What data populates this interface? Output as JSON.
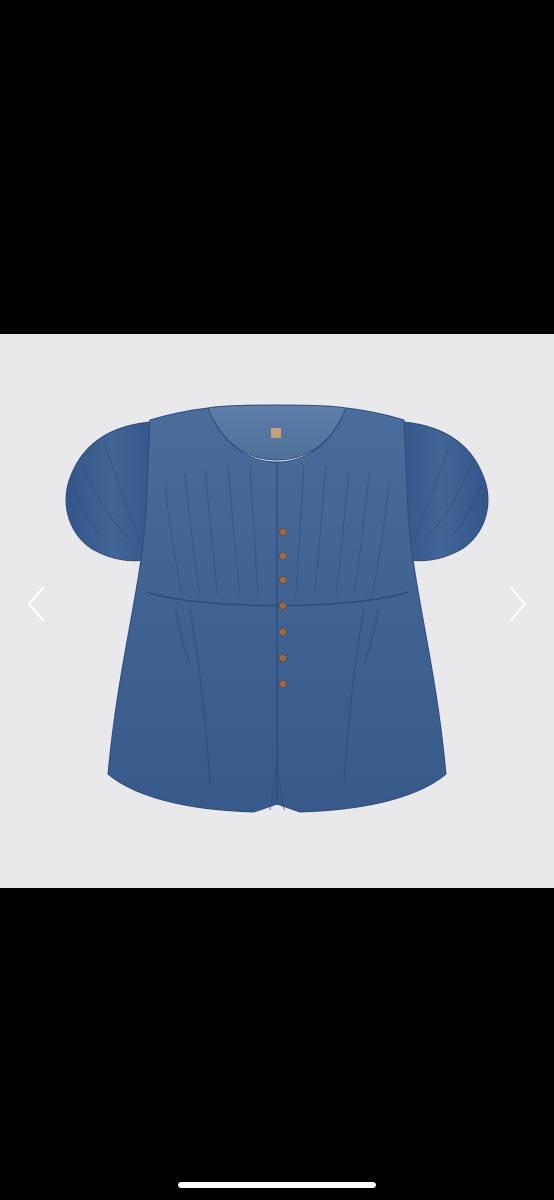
{
  "viewer": {
    "background_color": "#000000",
    "stage_color": "#e9e9eb",
    "prev_icon": "chevron-left-icon",
    "next_icon": "chevron-right-icon",
    "indicator_color": "#ffffff"
  },
  "product": {
    "image_subject": "denim-puff-sleeve-blouse",
    "fabric_color": "#3d5f8f",
    "button_color": "#9a6a4a",
    "label_color": "#c9a07a"
  }
}
